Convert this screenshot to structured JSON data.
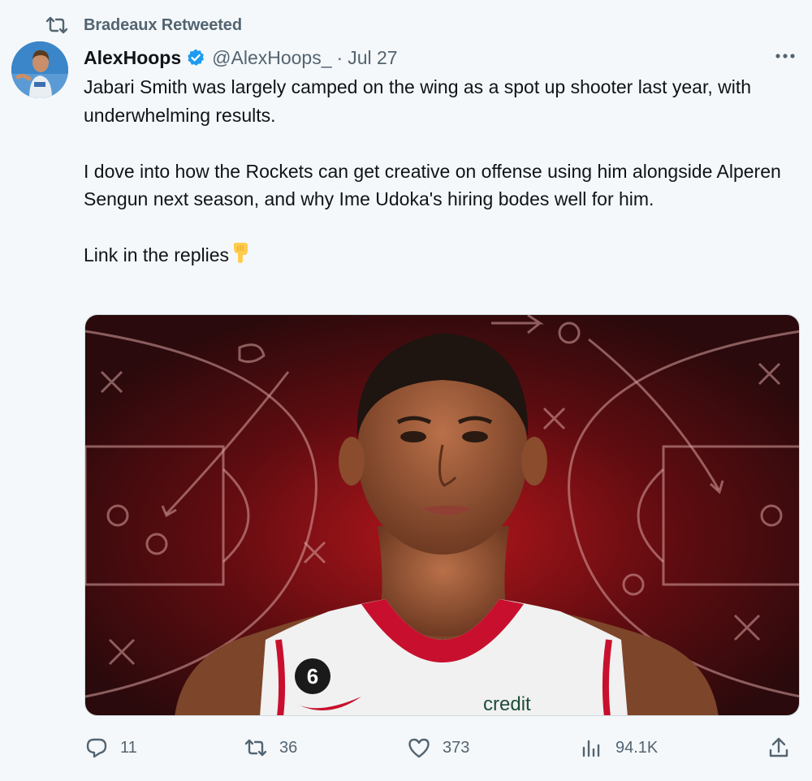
{
  "retweet": {
    "label": "Bradeaux Retweeted",
    "icon": "retweet-icon"
  },
  "author": {
    "name": "AlexHoops",
    "handle": "@AlexHoops_",
    "separator": "·",
    "date": "Jul 27",
    "verified_icon": "verified-badge-icon",
    "verified_color": "#1d9bf0"
  },
  "tweet": {
    "paragraphs": [
      "Jabari Smith was largely camped on the wing as a spot up shooter last year, with underwhelming results.",
      "I dove into how the Rockets can get creative on offense using him alongside Alperen Sengun next season, and why Ime Udoka's hiring bodes well for him.",
      "Link in the replies"
    ],
    "trailing_emoji": "point-down-emoji"
  },
  "media": {
    "jersey_number": "6",
    "jersey_text": "credit",
    "accent_color": "#c8102e"
  },
  "actions": {
    "reply": {
      "icon": "reply-icon",
      "count": "11"
    },
    "retweet": {
      "icon": "retweet-icon",
      "count": "36"
    },
    "like": {
      "icon": "heart-icon",
      "count": "373"
    },
    "views": {
      "icon": "views-icon",
      "count": "94.1K"
    },
    "share": {
      "icon": "share-icon"
    }
  },
  "colors": {
    "background": "#f5f8fa",
    "secondary_text": "#536471",
    "primary_text": "#0f1419"
  }
}
